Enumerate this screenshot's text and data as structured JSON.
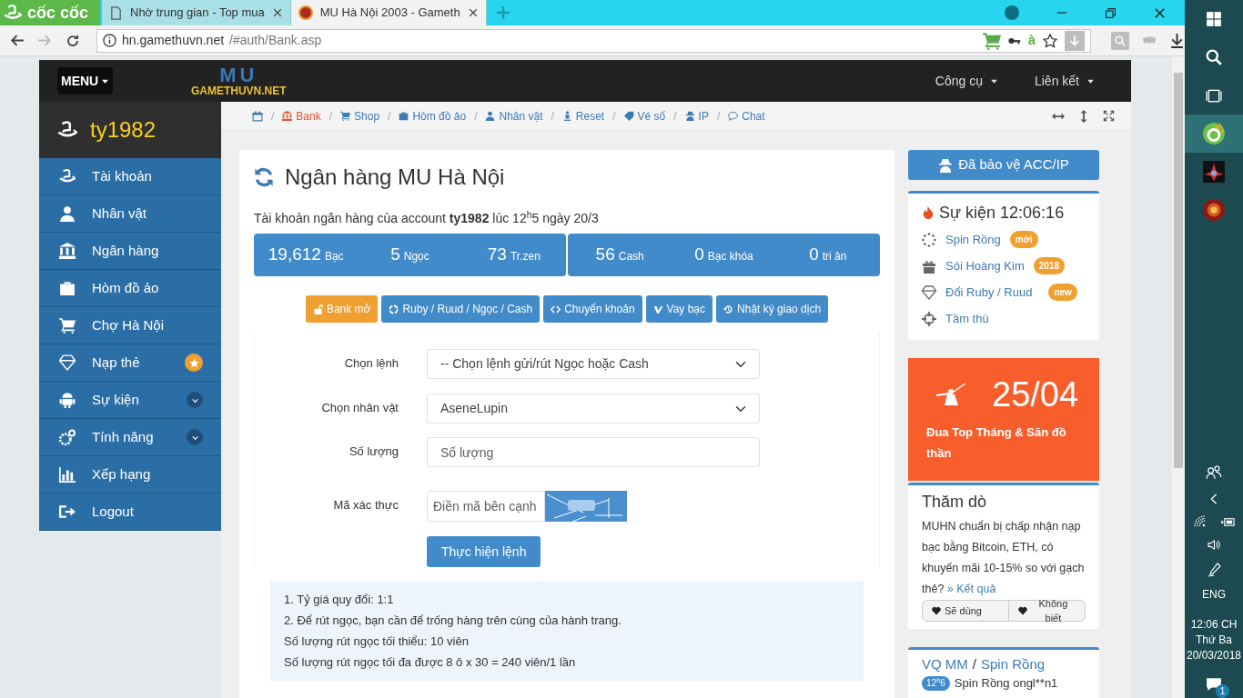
{
  "browser": {
    "brand": "cốc cốc",
    "tabs": [
      {
        "title": "Nhờ trung gian - Top mua",
        "selected": false
      },
      {
        "title": "MU Hà Nội 2003 - Gameth",
        "selected": true
      }
    ],
    "address": {
      "host": "hn.gamethuvn.net",
      "path": "/#auth/Bank.asp"
    },
    "extension_label": "à"
  },
  "navbar": {
    "menu": "MENU",
    "logo": {
      "title": "MU",
      "subtitle": "GAMETHUVN.NET"
    },
    "links": [
      "Công cụ",
      "Liên kết"
    ]
  },
  "sidebar": {
    "user": "ty1982",
    "items": [
      {
        "label": "Tài khoản",
        "kind": "plain"
      },
      {
        "label": "Nhân vật",
        "kind": "plain"
      },
      {
        "label": "Ngân hàng",
        "kind": "plain"
      },
      {
        "label": "Hòm đồ ảo",
        "kind": "plain"
      },
      {
        "label": "Chợ Hà Nội",
        "kind": "plain"
      },
      {
        "label": "Nạp thẻ",
        "kind": "starred"
      },
      {
        "label": "Sự kiện",
        "kind": "group",
        "expanded": false
      },
      {
        "label": "Tính năng",
        "kind": "group",
        "expanded": false
      },
      {
        "label": "Xếp hạng",
        "kind": "plain"
      },
      {
        "label": "Logout",
        "kind": "plain"
      }
    ]
  },
  "breadcrumb": [
    {
      "separator": "/",
      "label": "Bank",
      "selected": true
    },
    {
      "separator": "/",
      "label": "Shop",
      "selected": false
    },
    {
      "separator": "/",
      "label": "Hòm đồ ảo",
      "selected": false
    },
    {
      "separator": "/",
      "label": "Nhân vật",
      "selected": false
    },
    {
      "separator": "/",
      "label": "Reset",
      "selected": false
    },
    {
      "separator": "/",
      "label": "Vé số",
      "selected": false
    },
    {
      "separator": "/",
      "label": "IP",
      "selected": false
    },
    {
      "separator": "/",
      "label": "Chat",
      "selected": false
    }
  ],
  "bank": {
    "title": "Ngân hàng MU Hà Nội",
    "account_line": "Tài khoản ngân hàng của account **ty1982** lúc 12$^{h}$5 ngày 20/3",
    "balance_groups": [
      {
        "items": [
          {
            "value": "19,612",
            "unit": "Bạc"
          },
          {
            "value": "5",
            "unit": "Ngọc"
          },
          {
            "value": "73",
            "unit": "Tr.zen"
          }
        ]
      },
      {
        "items": [
          {
            "value": "56",
            "unit": "Cash"
          },
          {
            "value": "0",
            "unit": "Bạc khóa"
          },
          {
            "value": "0",
            "unit": "tri ân"
          }
        ]
      }
    ],
    "actions": [
      {
        "label": "Bank mở",
        "kind": "warning"
      },
      {
        "label": "Ruby / Ruud / Ngọc / Cash",
        "kind": "primary"
      },
      {
        "label": "Chuyển khoản",
        "kind": "primary"
      },
      {
        "label": "Vay bạc",
        "kind": "primary"
      },
      {
        "label": "Nhật ký giao dịch",
        "kind": "primary"
      }
    ],
    "form": {
      "fields": [
        {
          "label": "Chọn lệnh",
          "kind": "select",
          "value": "-- Chọn lệnh gửi/rút Ngọc hoặc Cash"
        },
        {
          "label": "Chọn nhân vật",
          "kind": "select",
          "value": "AseneLupin"
        },
        {
          "label": "Số lượng",
          "kind": "input",
          "placeholder": "Số lượng"
        },
        {
          "label": "Mã xác thực",
          "kind": "captcha",
          "placeholder": "Điền mã bên cạnh"
        }
      ],
      "submit": "Thực hiện lệnh"
    },
    "notes": [
      "1. Tỷ giá quy đổi: 1:1",
      "2. Để rút ngọc, bạn cần để trống hàng trên cùng của hành trang.",
      "Số lượng rút ngọc tối thiểu: 10 viên",
      "Số lượng rút ngọc tối đa được 8 ô x 30 = 240 viên/1 lần"
    ]
  },
  "right": {
    "protect_button": "Đã bảo vệ ACC/IP",
    "events": {
      "title": "Sự kiện 12:06:16",
      "items": [
        {
          "label": "Spin Rồng",
          "badge": "mới"
        },
        {
          "label": "Sói Hoàng Kim",
          "badge": "2018"
        },
        {
          "label": "Đổi Ruby / Ruud",
          "badge": "new"
        },
        {
          "label": "Tầm thù"
        }
      ]
    },
    "promo": {
      "date": "25/04",
      "text": "Đua Top Tháng & Săn đồ thần"
    },
    "poll": {
      "title": "Thăm dò",
      "question": "MUHN chuẩn bị chấp nhận nạp bạc bằng Bitcoin, ETH, có khuyến mãi 10-15% so với gạch thẻ?",
      "results_link": "» Kết quả",
      "buttons": [
        "Sẽ dùng",
        "Không biết"
      ]
    },
    "spin": {
      "title_left": "VQ MM",
      "title_separator": "/",
      "title_right": "Spin Rồng",
      "entry_time": "12$^{h}$6",
      "entry_text": "Spin Rồng ongl**n1"
    }
  },
  "taskbar": {
    "language": "ENG",
    "time": "12:06 CH",
    "day": "Thứ Ba",
    "date": "20/03/2018",
    "notifications": "1"
  }
}
